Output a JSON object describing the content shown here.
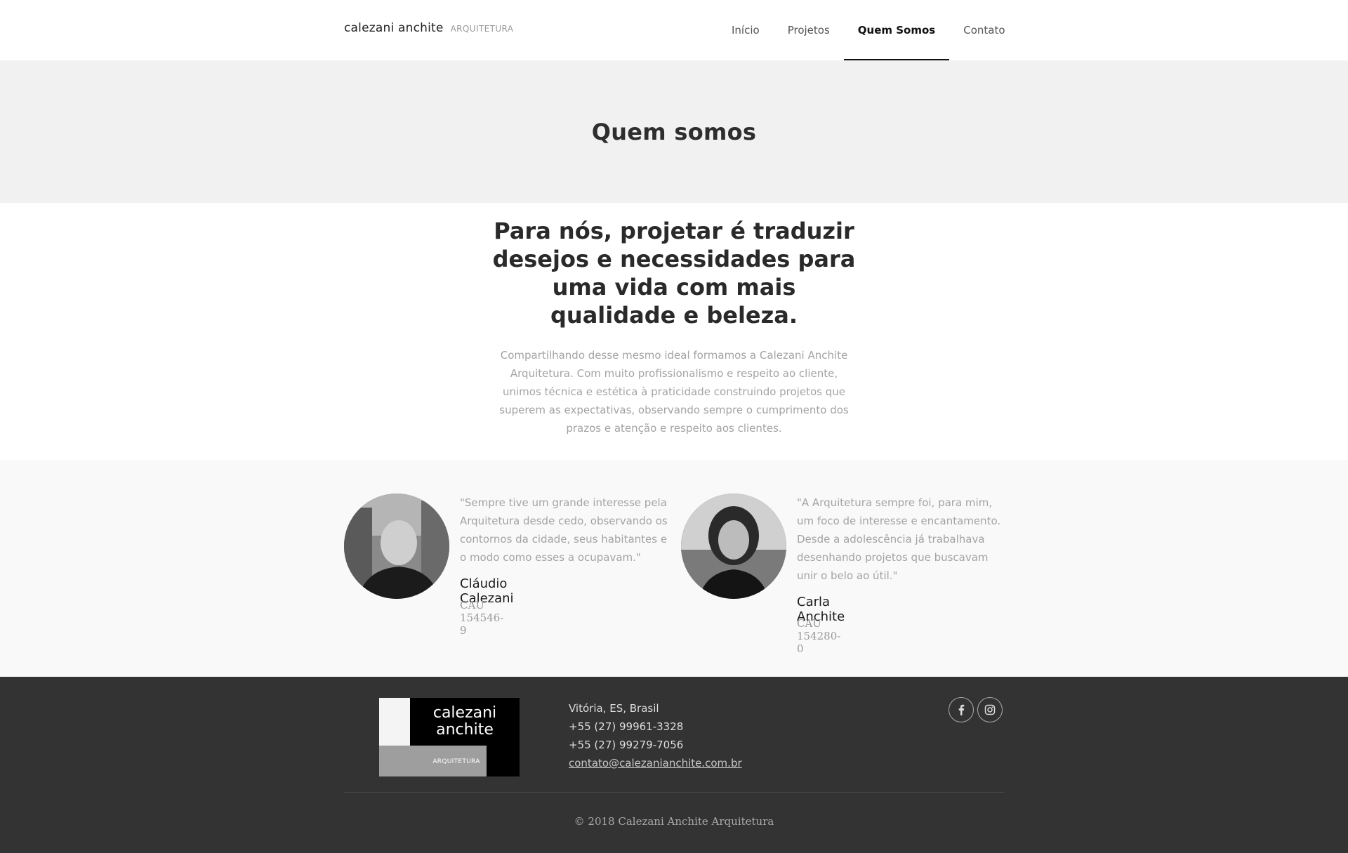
{
  "header": {
    "logo_main": "calezani anchite",
    "logo_sub": "ARQUITETURA",
    "nav": [
      {
        "label": "Início"
      },
      {
        "label": "Projetos"
      },
      {
        "label": "Quem Somos",
        "active": true
      },
      {
        "label": "Contato"
      }
    ]
  },
  "title_band": {
    "title": "Quem somos"
  },
  "intro": {
    "headline": "Para nós, projetar é traduzir desejos e necessidades para uma vida com mais qualidade e beleza.",
    "text": "Compartilhando desse mesmo ideal formamos a Calezani Anchite Arquitetura. Com muito profissionalismo e respeito ao cliente, unimos técnica e estética à praticidade construindo projetos que superem as expectativas, observando sempre o cumprimento dos prazos e atenção e respeito aos clientes."
  },
  "team": [
    {
      "quote": "\"Sempre tive um grande interesse pela Arquitetura desde cedo, observando os contornos da cidade, seus habitantes e o modo como esses a ocupavam.\"",
      "name": "Cláudio Calezani",
      "cau": "CAU 154546-9"
    },
    {
      "quote": "\"A Arquitetura sempre foi, para mim, um foco de interesse e encantamento. Desde a adolescência já trabalhava desenhando projetos que buscavam unir o belo ao útil.\"",
      "name": "Carla Anchite",
      "cau": "CAU 154280-0"
    }
  ],
  "footer": {
    "logo_name": "calezani anchite",
    "logo_sub": "ARQUITETURA",
    "city": "Vitória, ES, Brasil",
    "phone1": "+55 (27) 99961-3328",
    "phone2": "+55 (27) 99279-7056",
    "email": "contato@calezanianchite.com.br",
    "social_icons": [
      "facebook-icon",
      "instagram-icon"
    ],
    "copyright": "© 2018 Calezani Anchite Arquitetura"
  },
  "colors": {
    "title_band_bg": "#f1f1f1",
    "team_bg": "#f9f9f9",
    "footer_bg": "#333333",
    "muted_text": "#a3a3a3"
  }
}
